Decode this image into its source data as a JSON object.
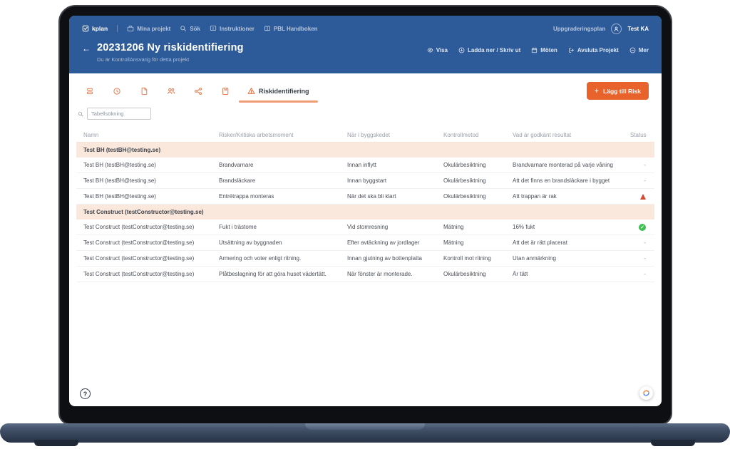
{
  "colors": {
    "header_blue": "#2d5a99",
    "accent_orange": "#e8622c",
    "tab_icon_orange": "#e87f52",
    "tab_underline": "#f19a73",
    "group_row_bg": "#fbe8dd",
    "warning_red": "#d44a32",
    "ok_green": "#3fbf53"
  },
  "topnav": {
    "logo": "kplan",
    "items": [
      {
        "label": "Mina projekt",
        "icon": "briefcase-icon"
      },
      {
        "label": "Sök",
        "icon": "search-icon"
      },
      {
        "label": "Instruktioner",
        "icon": "instructions-icon"
      },
      {
        "label": "PBL Handboken",
        "icon": "book-icon"
      }
    ],
    "upgrade_label": "Uppgraderingsplan",
    "user": "Test KA"
  },
  "project_header": {
    "title": "20231206 Ny riskidentifiering",
    "subtitle": "Du är KontrollAnsvarig för detta projekt",
    "actions": [
      {
        "label": "Visa",
        "icon": "eye-icon"
      },
      {
        "label": "Ladda ner / Skriv ut",
        "icon": "download-icon"
      },
      {
        "label": "Möten",
        "icon": "calendar-icon"
      },
      {
        "label": "Avsluta Projekt",
        "icon": "exit-icon"
      },
      {
        "label": "Mer",
        "icon": "circle-minus-icon"
      }
    ]
  },
  "tabs": {
    "icon_tabs": [
      {
        "icon": "stack-icon"
      },
      {
        "icon": "clock-icon"
      },
      {
        "icon": "document-icon"
      },
      {
        "icon": "users-icon"
      },
      {
        "icon": "share-icon"
      },
      {
        "icon": "journal-icon"
      }
    ],
    "active_label": "Riskidentifiering",
    "active_icon": "warning-triangle-icon"
  },
  "toolbar": {
    "add_risk_label": "Lägg till Risk"
  },
  "search": {
    "placeholder": "Tabellsökning"
  },
  "table": {
    "columns": [
      "Namn",
      "Risker/Kritiska arbetsmoment",
      "När i byggskedet",
      "Kontrollmetod",
      "Vad är godkänt resultat",
      "Status"
    ],
    "groups": [
      {
        "name": "Test BH (testBH@testing.se)",
        "rows": [
          {
            "cells": [
              "Test BH (testBH@testing.se)",
              "Brandvarnare",
              "Innan inflytt",
              "Okulärbesiktning",
              "Brandvarnare monterad på varje våning"
            ],
            "status": "-"
          },
          {
            "cells": [
              "Test BH (testBH@testing.se)",
              "Brandsläckare",
              "Innan byggstart",
              "Okulärbesiktning",
              "Att det finns en brandsläckare i bygget"
            ],
            "status": "-"
          },
          {
            "cells": [
              "Test BH (testBH@testing.se)",
              "Entrétrappa monteras",
              "När det ska bli klart",
              "Okulärbesiktning",
              "Att trappan är rak"
            ],
            "status": "warning"
          }
        ]
      },
      {
        "name": "Test Construct (testConstructor@testing.se)",
        "rows": [
          {
            "cells": [
              "Test Construct (testConstructor@testing.se)",
              "Fukt i trästome",
              "Vid stomresning",
              "Mätning",
              "16% fukt"
            ],
            "status": "ok"
          },
          {
            "cells": [
              "Test Construct (testConstructor@testing.se)",
              "Utsättning av byggnaden",
              "Efter avtäckning av jordlager",
              "Mätning",
              "Att det är rätt placerat"
            ],
            "status": "-"
          },
          {
            "cells": [
              "Test Construct (testConstructor@testing.se)",
              "Armering och voter enligt ritning.",
              "Innan gjutning av bottenplatta",
              "Kontroll mot ritning",
              "Utan anmärkning"
            ],
            "status": "-"
          },
          {
            "cells": [
              "Test Construct (testConstructor@testing.se)",
              "Plåtbeslagning för att göra huset vädertätt.",
              "När fönster är monterade.",
              "Okulärbesiktning",
              "Är tätt"
            ],
            "status": "-"
          }
        ]
      }
    ]
  },
  "footer": {
    "help": "?",
    "sync_icon": "sync-arrows-icon"
  }
}
